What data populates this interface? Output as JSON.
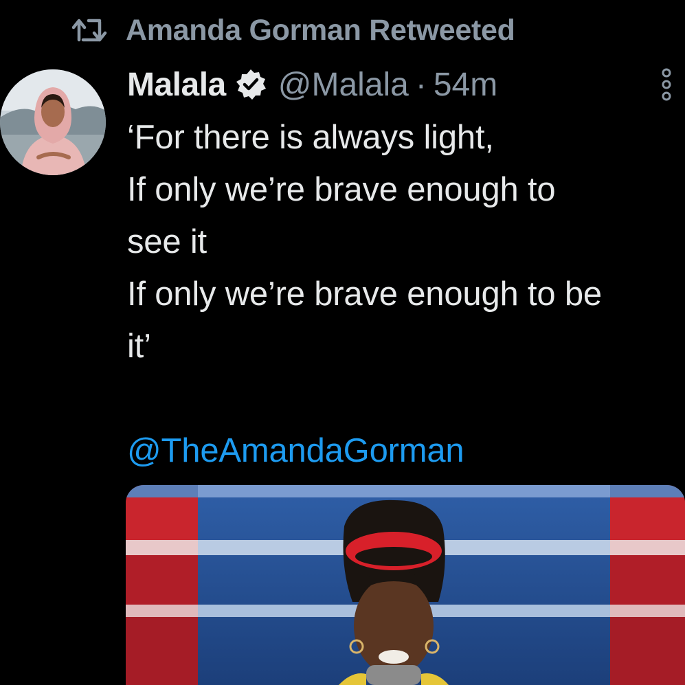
{
  "retweet": {
    "label": "Amanda Gorman Retweeted",
    "icon": "retweet-icon"
  },
  "tweet": {
    "display_name": "Malala",
    "verified": true,
    "handle": "@Malala",
    "separator": "·",
    "time": "54m",
    "lines": [
      "‘For there is always light,",
      "If only we’re brave enough to",
      "see it",
      "If only we’re brave enough to be",
      "it’"
    ],
    "mention": "@TheAmandaGorman",
    "media_icon": "photo"
  },
  "colors": {
    "background": "#000000",
    "text": "#e7e9ea",
    "muted": "#8b98a5",
    "link": "#1d9bf0"
  }
}
